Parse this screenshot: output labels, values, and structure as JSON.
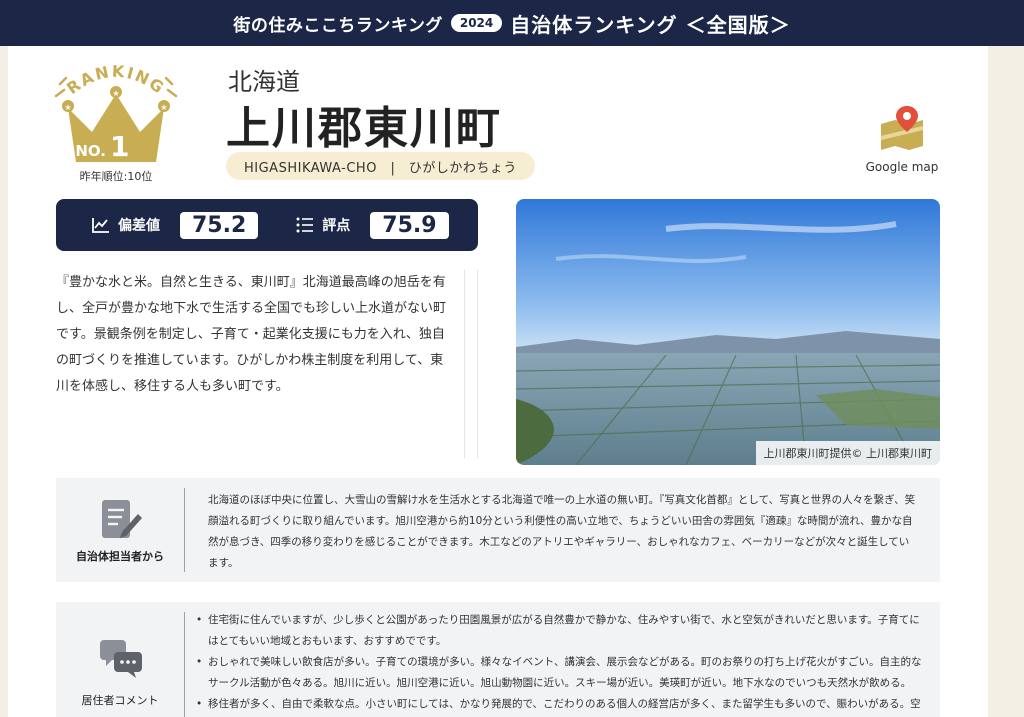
{
  "header": {
    "brand": "街の住みここちランキング",
    "year": "2024",
    "title": "自治体ランキング ＜全国版＞"
  },
  "ranking": {
    "badge_text": "RANKING",
    "no_label": "NO.",
    "rank": "1",
    "previous": "昨年順位:10位",
    "crown_color": "#c9ad52"
  },
  "municipality": {
    "prefecture": "北海道",
    "name": "上川郡東川町",
    "reading": "HIGASHIKAWA-CHO　|　ひがしかわちょう"
  },
  "map_link": {
    "label": "Google map",
    "icon": "map-pin-icon"
  },
  "scores": {
    "deviation_label": "偏差値",
    "deviation_value": "75.2",
    "rating_label": "評点",
    "rating_value": "75.9"
  },
  "intro": "『豊かな水と米。自然と生きる、東川町』北海道最高峰の旭岳を有し、全戸が豊かな地下水で生活する全国でも珍しい上水道がない町です。景観条例を制定し、子育て・起業化支援にも力を入れ、独自の町づくりを推進しています。ひがしかわ株主制度を利用して、東川を体感し、移住する人も多い町です。",
  "photo": {
    "caption": "上川郡東川町提供© 上川郡東川町"
  },
  "government": {
    "title": "自治体担当者から",
    "icon": "memo-pen-icon",
    "text": "北海道のほぼ中央に位置し、大雪山の雪解け水を生活水とする北海道で唯一の上水道の無い町。『写真文化首都』として、写真と世界の人々を繋ぎ、笑顔溢れる町づくりに取り組んでいます。旭川空港から約10分という利便性の高い立地で、ちょうどいい田舎の雰囲気『適疎』な時間が流れ、豊かな自然が息づき、四季の移り変わりを感じることができます。木工などのアトリエやギャラリー、おしゃれなカフェ、ベーカリーなどが次々と誕生しています。"
  },
  "residents": {
    "title": "居住者コメント",
    "icon": "speech-bubbles-icon",
    "comments": [
      "住宅街に住んでいますが、少し歩くと公園があったり田園風景が広がる自然豊かで静かな、住みやすい街で、水と空気がきれいだと思います。子育てにはとてもいい地域とおもいます、おすすめでです。",
      "おしゃれで美味しい飲食店が多い。子育ての環境が多い。様々なイベント、講演会、展示会などがある。町のお祭りの打ち上げ花火がすごい。自主的なサークル活動が色々ある。旭川に近い。旭川空港に近い。旭山動物園に近い。スキー場が近い。美瑛町が近い。地下水なのでいつも天然水が飲める。",
      "移住者が多く、自由で柔軟な点。小さい町にしては、かなり発展的で、こだわりのある個人の経営店が多く、また留学生も多いので、賑わいがある。空"
    ]
  }
}
